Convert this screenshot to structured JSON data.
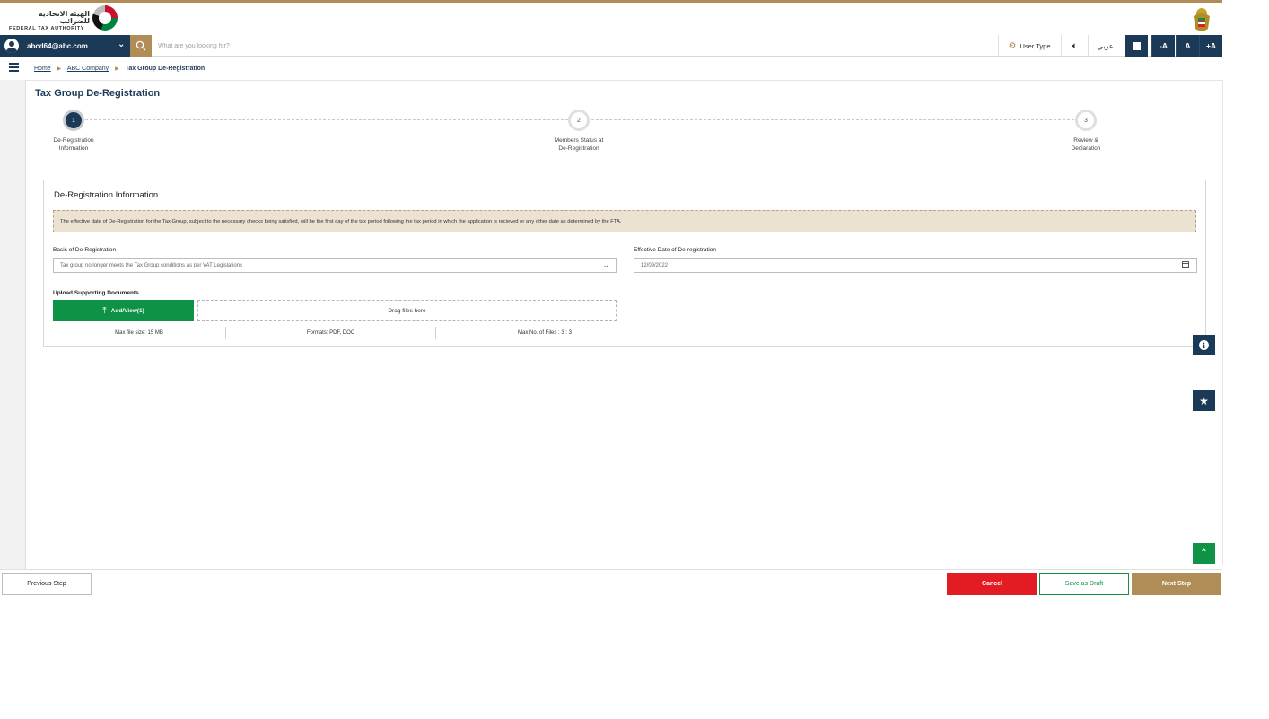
{
  "header": {
    "logo_ar": "الهيئة الاتحادية للضرائب",
    "logo_en": "FEDERAL TAX AUTHORITY"
  },
  "navbar": {
    "user_email": "abcd64@abc.com",
    "search_placeholder": "What are you looking for?",
    "user_type": "User Type",
    "arabic_label": "عربي",
    "font_decrease": "-A",
    "font_reset": "A",
    "font_increase": "+A"
  },
  "breadcrumb": {
    "home": "Home",
    "company": "ABC Company",
    "current": "Tax Group De-Registration"
  },
  "page_title": "Tax Group De-Registration",
  "steps": [
    {
      "number": "1",
      "label": "De-Registration\nInformation",
      "state": "active"
    },
    {
      "number": "2",
      "label": "Members Status at\nDe-Registration",
      "state": "pending"
    },
    {
      "number": "3",
      "label": "Review &\nDeclaration",
      "state": "pending"
    }
  ],
  "card": {
    "title": "De-Registration Information",
    "notice": "The effective date of De-Registration for the Tax Group, subject to the necessary checks being satisfied, will be the first day of the tax period following the tax period in which the application is recieved or any other date as determined by the FTA.",
    "basis_label": "Basis of De-Registration",
    "basis_value": "Tax group no longer meets the Tax Group conditions as per VAT Legislations",
    "date_label": "Effective Date of De-registration",
    "date_value": "12/09/2022",
    "upload_label": "Upload Supporting Documents",
    "add_view_label": "Add/View(1)",
    "drop_label": "Drag files here",
    "max_size": "Max file size: 15 MB",
    "formats": "Formats: PDF, DOC",
    "max_files": "Max No. of Files : 3 : 3"
  },
  "footer": {
    "previous": "Previous Step",
    "cancel": "Cancel",
    "draft": "Save as Draft",
    "next": "Next Step"
  },
  "icons": [
    "user-avatar-icon",
    "chevron-down-icon",
    "search-icon",
    "gear-icon",
    "speaker-icon",
    "contrast-icon",
    "hamburger-icon",
    "calendar-icon",
    "upload-icon",
    "info-icon",
    "star-icon",
    "scroll-top-icon"
  ],
  "colors": {
    "primary_navy": "#1b3a57",
    "gold": "#b08d57",
    "green": "#0e9246",
    "red": "#e31b23",
    "notice_bg": "#ece2d1"
  }
}
